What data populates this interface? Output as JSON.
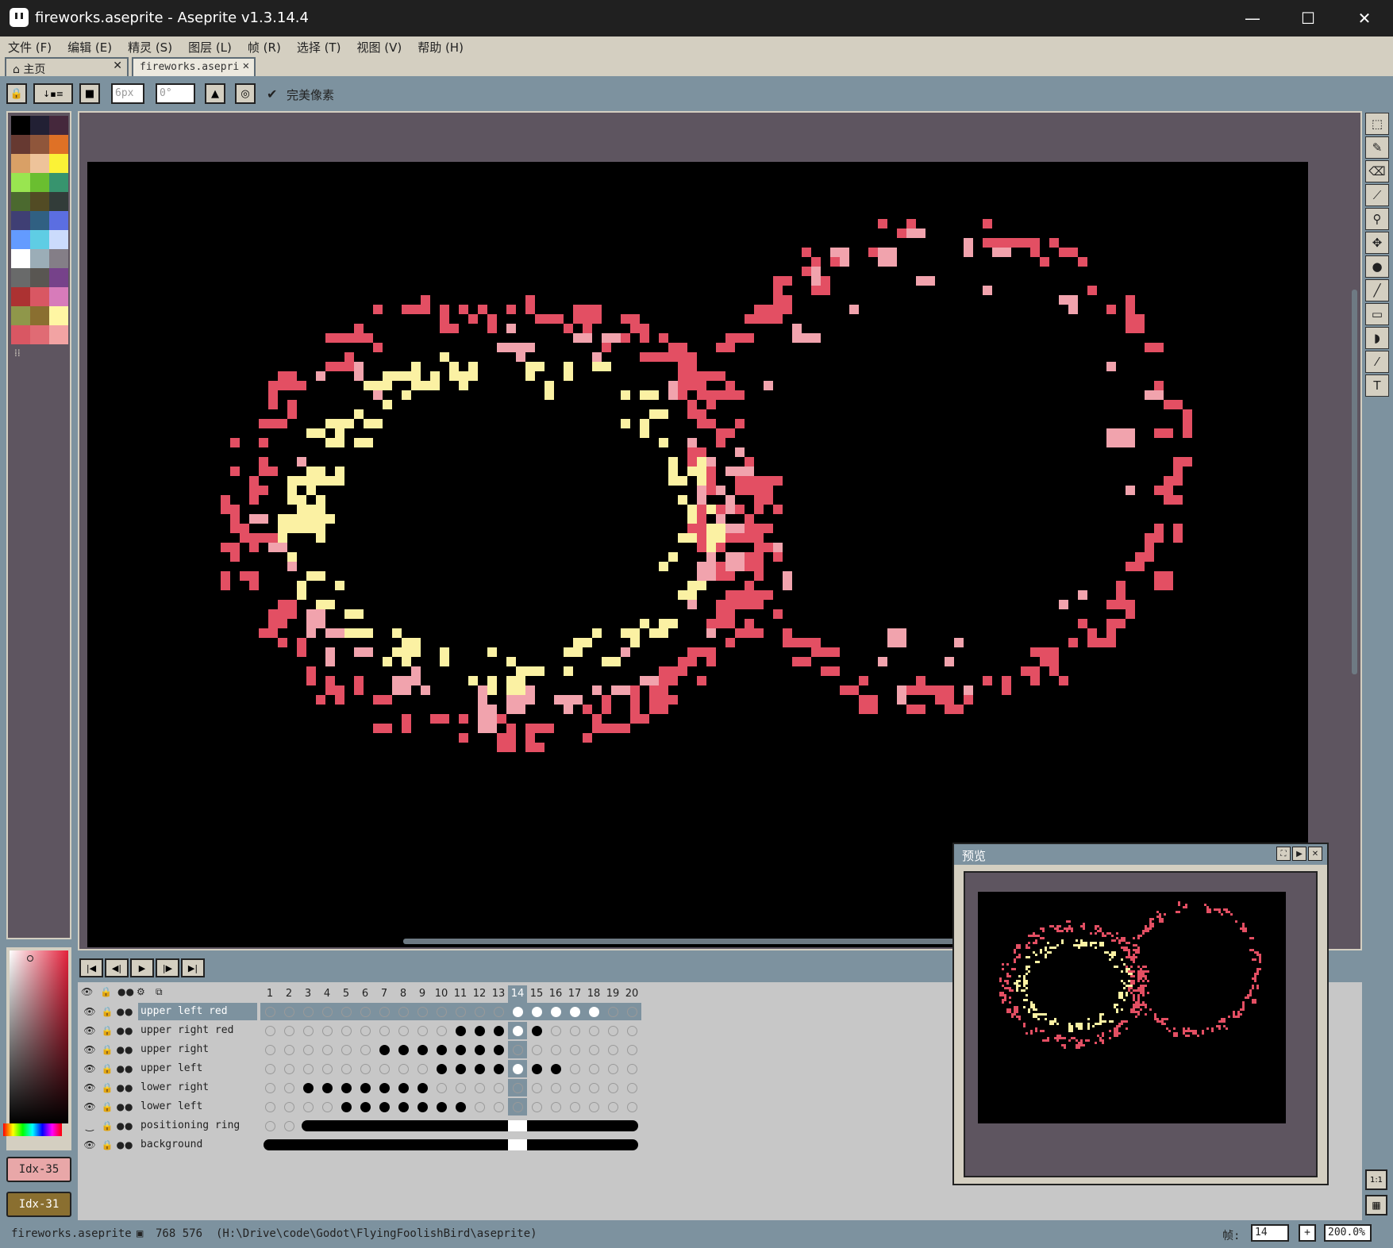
{
  "window": {
    "title": "fireworks.aseprite - Aseprite v1.3.14.4",
    "minimize": "—",
    "maximize": "☐",
    "close": "✕"
  },
  "menu": [
    "文件 (F)",
    "编辑 (E)",
    "精灵 (S)",
    "图层 (L)",
    "帧 (R)",
    "选择 (T)",
    "视图 (V)",
    "帮助 (H)"
  ],
  "tabs": {
    "home": "主页",
    "file": "fireworks.asepri",
    "close": "✕"
  },
  "toolbar": {
    "brush_size": "6px",
    "angle": "0°",
    "pixel_perfect": "完美像素",
    "check": "✔"
  },
  "palette": {
    "colors": [
      "#000000",
      "#222034",
      "#45283c",
      "#663931",
      "#8f563b",
      "#df7126",
      "#d9a066",
      "#eec39a",
      "#fbf236",
      "#99e550",
      "#6abe30",
      "#37946e",
      "#4b692f",
      "#524b24",
      "#323c39",
      "#3f3f74",
      "#306082",
      "#5b6ee1",
      "#639bff",
      "#5fcde4",
      "#cbdbfc",
      "#ffffff",
      "#9badb7",
      "#847e87",
      "#696a6a",
      "#595652",
      "#76428a",
      "#ac3232",
      "#d95763",
      "#d77bba",
      "#8f974a",
      "#8a6f30",
      "#fff6a3",
      "#d95763",
      "#e06b74",
      "#f2a3a3"
    ]
  },
  "fg_color": {
    "label": "Idx-35",
    "color": "#e8a7a8"
  },
  "bg_color": {
    "label": "Idx-31",
    "color": "#8a6f30"
  },
  "colors": {
    "red": "#e34f63",
    "pink": "#f1a3ad",
    "yellow": "#fbf1a3",
    "sprite_bg": "#000000",
    "canvas_bg": "#5e5560"
  },
  "timeline": {
    "frames": [
      "1",
      "2",
      "3",
      "4",
      "5",
      "6",
      "7",
      "8",
      "9",
      "10",
      "11",
      "12",
      "13",
      "14",
      "15",
      "16",
      "17",
      "18",
      "19",
      "20"
    ],
    "current_frame": 14,
    "layers": [
      {
        "name": "upper left red",
        "cels": [
          0,
          0,
          0,
          0,
          0,
          0,
          0,
          0,
          0,
          0,
          0,
          0,
          0,
          2,
          2,
          2,
          2,
          2,
          0,
          0
        ],
        "selected": true
      },
      {
        "name": "upper right red",
        "cels": [
          0,
          0,
          0,
          0,
          0,
          0,
          0,
          0,
          0,
          0,
          1,
          1,
          1,
          2,
          1,
          0,
          0,
          0,
          0,
          0
        ]
      },
      {
        "name": "upper right",
        "cels": [
          0,
          0,
          0,
          0,
          0,
          0,
          1,
          1,
          1,
          1,
          1,
          1,
          1,
          0,
          0,
          0,
          0,
          0,
          0,
          0
        ]
      },
      {
        "name": "upper left",
        "cels": [
          0,
          0,
          0,
          0,
          0,
          0,
          0,
          0,
          0,
          1,
          1,
          1,
          1,
          2,
          1,
          1,
          0,
          0,
          0,
          0
        ]
      },
      {
        "name": "lower right",
        "cels": [
          0,
          0,
          1,
          1,
          1,
          1,
          1,
          1,
          1,
          0,
          0,
          0,
          0,
          0,
          0,
          0,
          0,
          0,
          0,
          0
        ]
      },
      {
        "name": "lower left",
        "cels": [
          0,
          0,
          0,
          0,
          1,
          1,
          1,
          1,
          1,
          1,
          1,
          0,
          0,
          0,
          0,
          0,
          0,
          0,
          0,
          0
        ]
      },
      {
        "name": "positioning ring",
        "cels": "bar",
        "bar_from": 3,
        "hidden": true
      },
      {
        "name": "background",
        "cels": "bar",
        "bar_from": 1
      }
    ]
  },
  "preview": {
    "title": "预览"
  },
  "status": {
    "filename": "fireworks.aseprite",
    "size": "768 576",
    "path": "(H:\\Drive\\code\\Godot\\FlyingFoolishBird\\aseprite)",
    "frame_label": "帧:",
    "frame_value": "14",
    "zoom": "200.0%",
    "plus": "+"
  }
}
